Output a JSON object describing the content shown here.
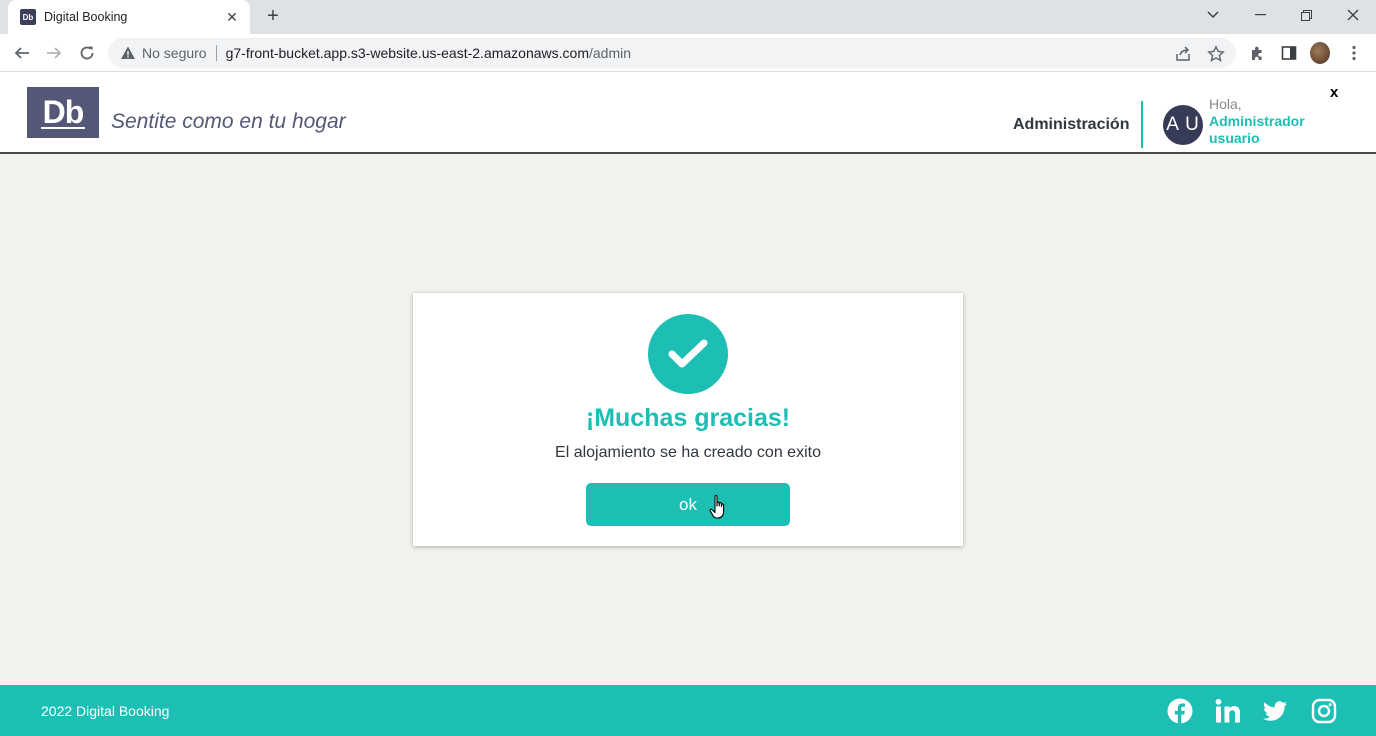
{
  "browser": {
    "tab_title": "Digital Booking",
    "tab_favicon": "Db",
    "new_tab": "+",
    "security_label": "No seguro",
    "url_host": "g7-front-bucket.app.s3-website.us-east-2.amazonaws.com",
    "url_path": "/admin"
  },
  "header": {
    "logo_text": "Db",
    "slogan": "Sentite como en tu hogar",
    "admin_link": "Administración",
    "avatar_initials": "A U",
    "greeting": "Hola,",
    "user_name": "Administrador usuario",
    "close": "x"
  },
  "modal": {
    "title": "¡Muchas gracias!",
    "message": "El alojamiento se ha creado con exito",
    "ok_label": "ok"
  },
  "footer": {
    "copyright": "2022 Digital Booking",
    "social_icons": [
      "facebook-icon",
      "linkedin-icon",
      "twitter-icon",
      "instagram-icon"
    ]
  },
  "colors": {
    "primary": "#1dbeb4",
    "dark": "#545776",
    "avatar": "#383b58",
    "background": "#f3f1ee"
  }
}
